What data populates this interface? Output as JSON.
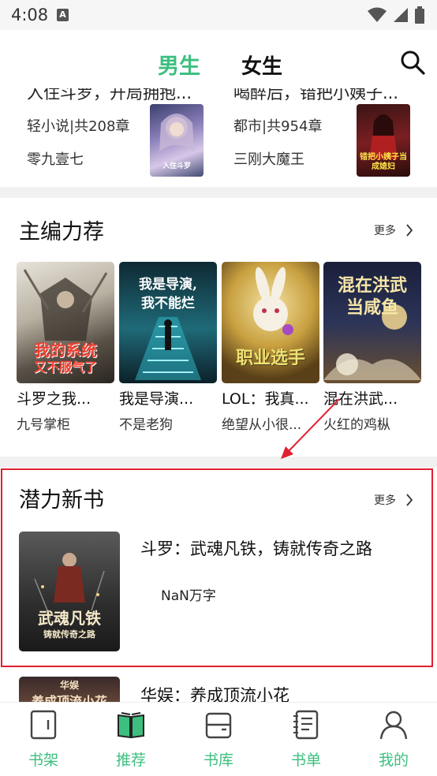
{
  "status_bar": {
    "time": "4:08",
    "notif_letter": "A"
  },
  "header": {
    "tab_male": "男生",
    "tab_female": "女生",
    "search_icon": "search-icon",
    "accent": "#3dbf7f"
  },
  "partial_row": [
    {
      "title": "入住斗罗，开局拥抱...",
      "meta": "轻小说|共208章",
      "author": "零九壹七",
      "cover_text": "入住斗罗"
    },
    {
      "title": "喝醉后，错把小姨子...",
      "meta": "都市|共954章",
      "author": "三刚大魔王",
      "cover_text": "错把小姨子当成媳妇"
    }
  ],
  "editor_picks": {
    "title": "主编力荐",
    "more": "更多",
    "books": [
      {
        "title": "斗罗之我...",
        "author": "九号掌柜",
        "cover_line1": "我的系统",
        "cover_line2": "又不服气了"
      },
      {
        "title": "我是导演...",
        "author": "不是老狗",
        "cover_line1": "我是导演,",
        "cover_line2": "我不能烂"
      },
      {
        "title": "LOL：我真...",
        "author": "绝望从小很...",
        "cover_line1": "职业选手",
        "cover_line2": ""
      },
      {
        "title": "混在洪武...",
        "author": "火红的鸡枞",
        "cover_line1": "混在洪武",
        "cover_line2": "当咸鱼"
      }
    ]
  },
  "new_books": {
    "title": "潜力新书",
    "more": "更多",
    "book": {
      "title": "斗罗：武魂凡铁，铸就传奇之路",
      "words": "NaN万字",
      "cover_line1": "武魂凡铁",
      "cover_line2": "铸就传奇之路"
    },
    "next_book": {
      "title": "华娱：养成顶流小花",
      "cover_line1": "华娱",
      "cover_line2": "养成顶流小花"
    }
  },
  "bottom_nav": [
    {
      "label": "书架",
      "icon": "bookshelf-icon"
    },
    {
      "label": "推荐",
      "icon": "recommend-book-icon"
    },
    {
      "label": "书库",
      "icon": "library-icon"
    },
    {
      "label": "书单",
      "icon": "booklist-icon"
    },
    {
      "label": "我的",
      "icon": "profile-icon"
    }
  ]
}
